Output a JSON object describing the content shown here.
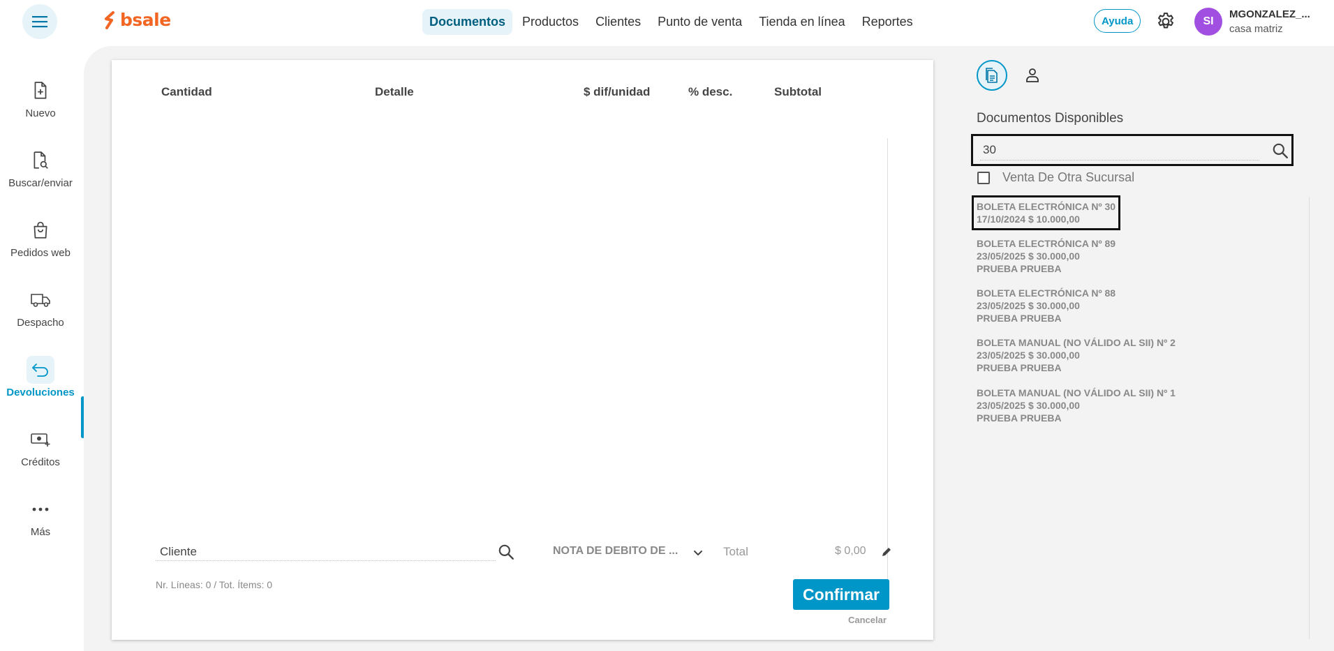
{
  "brand": {
    "name": "bsale",
    "color": "#f26522"
  },
  "colors": {
    "accent": "#0096c7",
    "avatar": "#a14fe0"
  },
  "nav": {
    "items": [
      {
        "label": "Documentos",
        "active": true
      },
      {
        "label": "Productos"
      },
      {
        "label": "Clientes"
      },
      {
        "label": "Punto de venta"
      },
      {
        "label": "Tienda en línea"
      },
      {
        "label": "Reportes"
      }
    ]
  },
  "header": {
    "help_label": "Ayuda",
    "user_initials": "SI",
    "user_name": "MGONZALEZ_...",
    "user_location": "casa matriz"
  },
  "sidebar": {
    "items": [
      {
        "label": "Nuevo",
        "icon": "file-plus-icon"
      },
      {
        "label": "Buscar/enviar",
        "icon": "file-search-icon"
      },
      {
        "label": "Pedidos web",
        "icon": "bag-icon"
      },
      {
        "label": "Despacho",
        "icon": "truck-icon"
      },
      {
        "label": "Devoluciones",
        "icon": "return-icon",
        "active": true
      },
      {
        "label": "Créditos",
        "icon": "cash-plus-icon"
      },
      {
        "label": "Más",
        "icon": "more-icon"
      }
    ]
  },
  "table": {
    "headers": [
      "Cantidad",
      "Detalle",
      "$ dif/unidad",
      "% desc.",
      "Subtotal"
    ]
  },
  "footer": {
    "client_placeholder": "Cliente",
    "doc_type": "NOTA DE DEBITO DE ...",
    "total_label": "Total",
    "total_value": "$ 0,00",
    "lines_info": "Nr. Líneas: 0 / Tot. Ítems: 0",
    "confirm_label": "Confirmar",
    "cancel_label": "Cancelar"
  },
  "panel": {
    "title": "Documentos Disponibles",
    "search_value": "30",
    "checkbox_label": "Venta De Otra Sucursal",
    "documents": [
      {
        "line1": "BOLETA ELECTRÓNICA Nº 30",
        "line2": "17/10/2024 $ 10.000,00",
        "line3": "",
        "selected": true
      },
      {
        "line1": "BOLETA ELECTRÓNICA Nº 89",
        "line2": "23/05/2025 $ 30.000,00",
        "line3": "PRUEBA PRUEBA"
      },
      {
        "line1": "BOLETA ELECTRÓNICA Nº 88",
        "line2": "23/05/2025 $ 30.000,00",
        "line3": "PRUEBA PRUEBA"
      },
      {
        "line1": "BOLETA MANUAL (NO VÁLIDO AL SII) Nº 2",
        "line2": "23/05/2025 $ 30.000,00",
        "line3": "PRUEBA PRUEBA"
      },
      {
        "line1": "BOLETA MANUAL (NO VÁLIDO AL SII) Nº 1",
        "line2": "23/05/2025 $ 30.000,00",
        "line3": "PRUEBA PRUEBA"
      }
    ]
  }
}
